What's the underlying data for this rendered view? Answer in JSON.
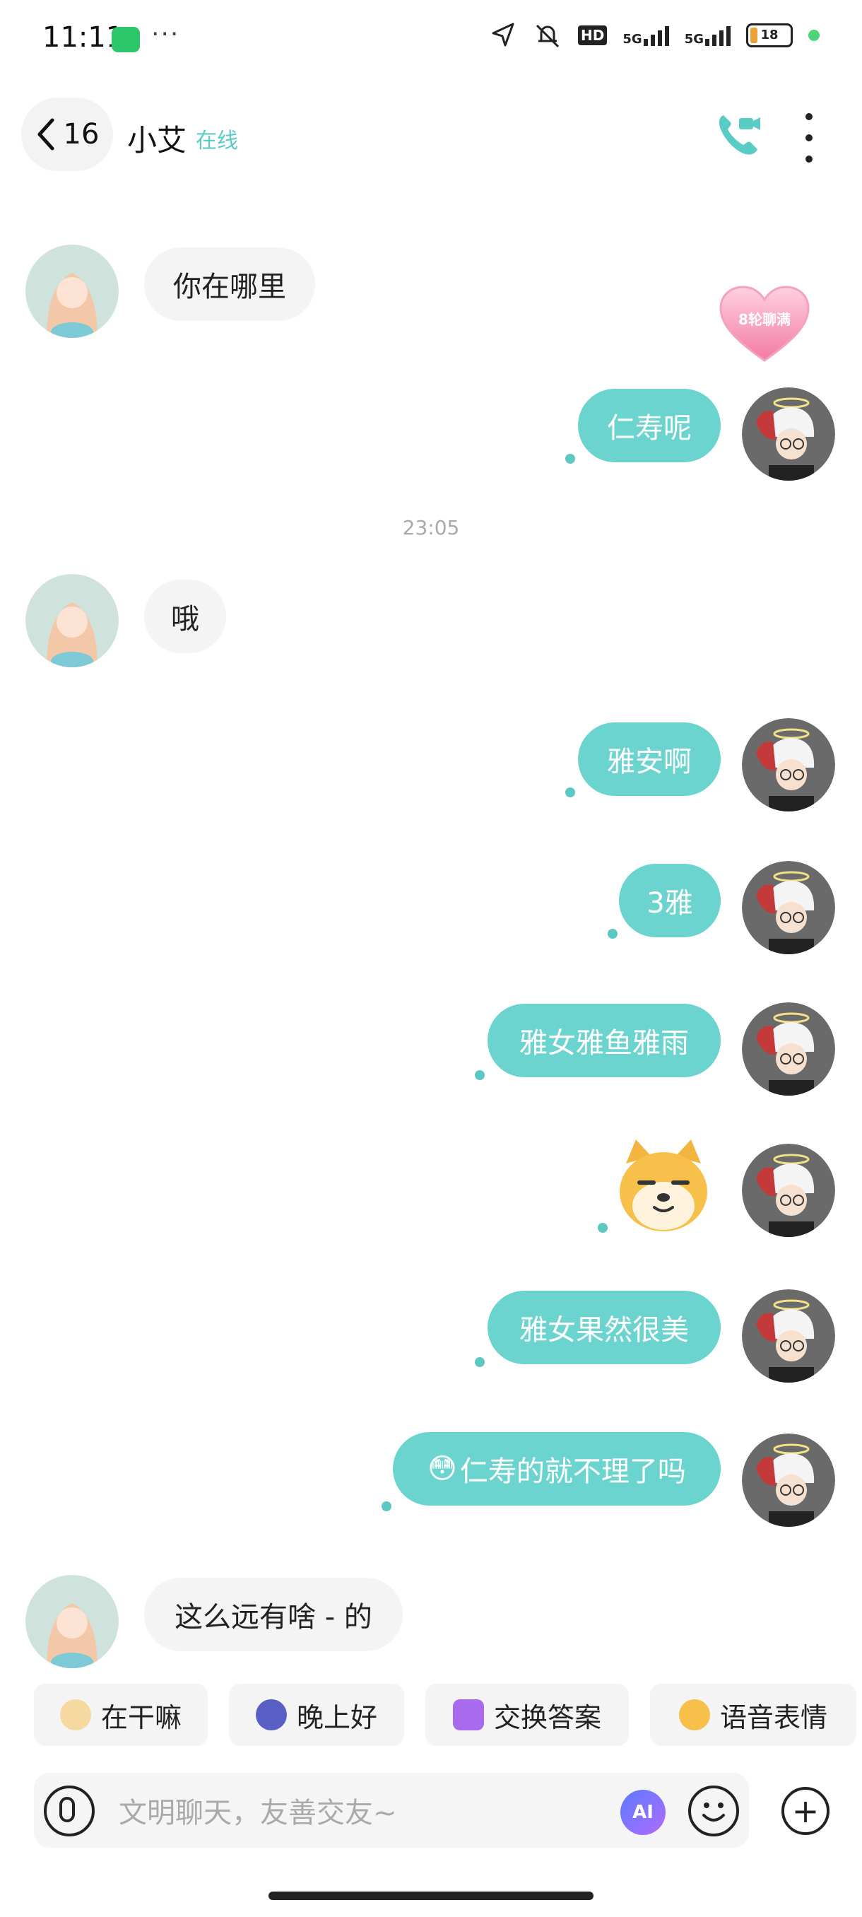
{
  "status_bar": {
    "time": "11:11",
    "dots": "···",
    "network1": "5G",
    "network2": "5G",
    "hd": "HD",
    "battery": "18"
  },
  "header": {
    "back_count": "16",
    "name": "小艾",
    "online": "在线"
  },
  "badge": {
    "text": "8轮聊满"
  },
  "timestamp": "23:05",
  "messages": [
    {
      "side": "left",
      "text": "你在哪里"
    },
    {
      "side": "right",
      "text": "仁寿呢"
    },
    {
      "side": "left",
      "text": "哦"
    },
    {
      "side": "right",
      "text": "雅安啊"
    },
    {
      "side": "right",
      "text": "3雅"
    },
    {
      "side": "right",
      "text": "雅女雅鱼雅雨"
    },
    {
      "side": "right",
      "sticker": "shiba-dog-sticker"
    },
    {
      "side": "right",
      "text": "雅女果然很美"
    },
    {
      "side": "right",
      "text": "仁寿的就不理了吗",
      "emoji": "😳"
    },
    {
      "side": "left",
      "text": "这么远有啥 - 的"
    }
  ],
  "quick_replies": [
    {
      "label": "在干嘛",
      "icon": "phone-hand-icon"
    },
    {
      "label": "晚上好",
      "icon": "moon-icon"
    },
    {
      "label": "交换答案",
      "icon": "exchange-icon"
    },
    {
      "label": "语音表情",
      "icon": "voice-emoji-icon"
    }
  ],
  "input": {
    "placeholder": "文明聊天，友善交友~",
    "ai_label": "AI"
  },
  "colors": {
    "accent": "#6cd4cf",
    "bubble_left": "#f4f4f4"
  }
}
